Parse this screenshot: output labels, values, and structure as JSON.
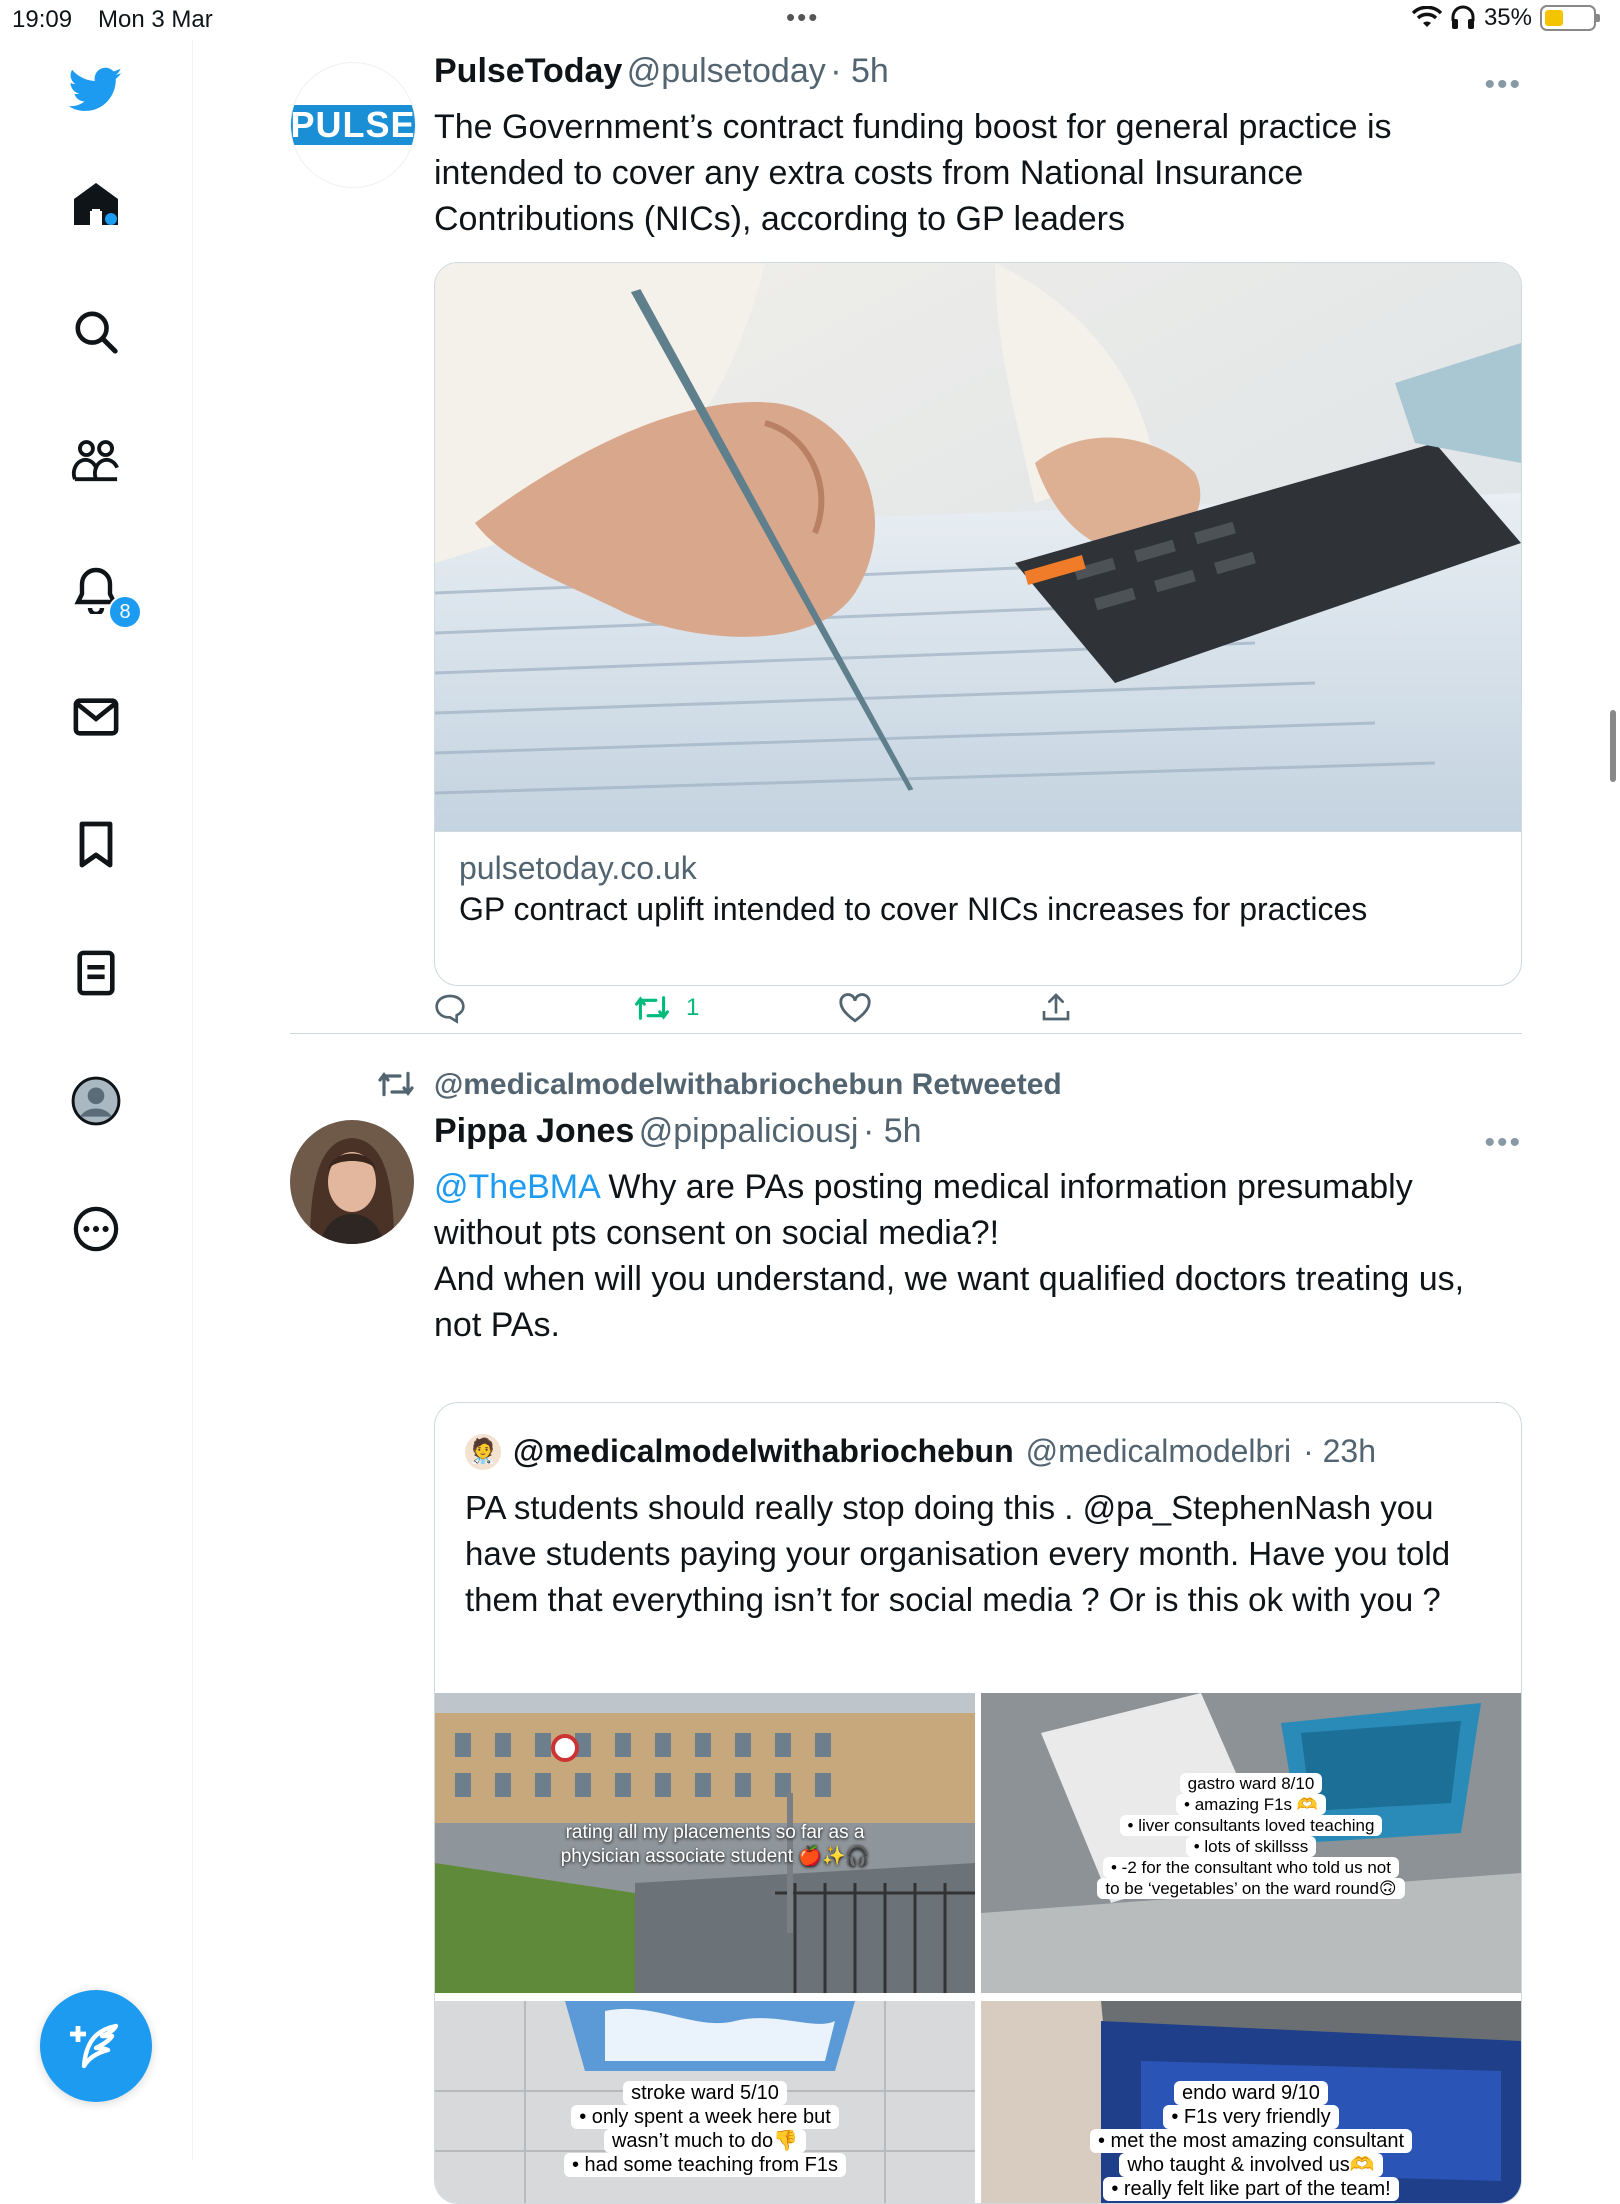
{
  "status_bar": {
    "time": "19:09",
    "date": "Mon 3 Mar",
    "battery": "35%"
  },
  "sidebar": {
    "notifications_count": "8"
  },
  "tweet1": {
    "avatar_text": "PULSE",
    "name": "PulseToday",
    "handle": "@pulsetoday",
    "time": "· 5h",
    "text": "The Government’s contract funding boost for general practice is intended to cover any extra costs from National Insurance Contributions (NICs), according to GP leaders",
    "card_domain": "pulsetoday.co.uk",
    "card_title": "GP contract uplift intended to cover NICs increases for practices",
    "retweets": "1"
  },
  "tweet2": {
    "retweeted_by": "@medicalmodelwithabriochebun Retweeted",
    "name": "Pippa Jones",
    "handle": "@pippaliciousj",
    "time": "· 5h",
    "mention": "@TheBMA",
    "text_line1": " Why are PAs posting medical information presumably without pts consent on social media?!",
    "text_line2": "And when will you understand, we want qualified doctors treating us, not PAs.",
    "quote": {
      "name": "@medicalmodelwithabriochebun",
      "handle": "@medicalmodelbri",
      "time": "· 23h",
      "text": "PA students should really stop doing this . @pa_StephenNash you have students paying your organisation every month. Have you told them that everything isn’t for social media ? Or is this ok with you ?",
      "images": [
        {
          "caption1": "rating all my placements so far as a",
          "caption2": "physician associate student 🍎✨🎧"
        },
        {
          "l1": "gastro ward 8/10",
          "l2": "• amazing F1s 🫶",
          "l3": "• liver consultants loved teaching",
          "l4": "• lots of skillsss",
          "l5": "• -2 for the consultant who told us not",
          "l6": "to be ‘vegetables’ on the ward round🙃"
        },
        {
          "l1": "stroke ward 5/10",
          "l2": "• only spent a week here but",
          "l3": "wasn’t much to do👎",
          "l4": "• had some teaching from F1s"
        },
        {
          "l1": "endo ward 9/10",
          "l2": "• F1s very friendly",
          "l3": "• met the most amazing consultant",
          "l4": "who taught & involved us🫶",
          "l5": "• really felt like part of the team!"
        }
      ]
    }
  }
}
